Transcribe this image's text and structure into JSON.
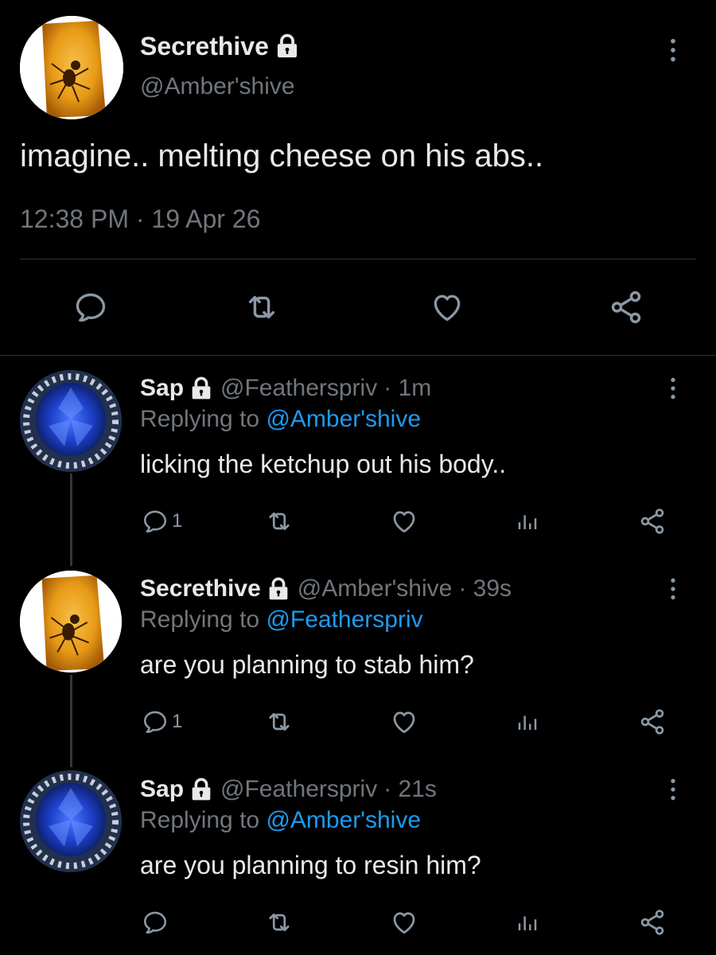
{
  "main_tweet": {
    "display_name": "Secrethive",
    "handle": "@Amber'shive",
    "text": "imagine.. melting cheese on his abs..",
    "timestamp": "12:38 PM · 19 Apr 26"
  },
  "replies": [
    {
      "display_name": "Sap",
      "handle": "@Featherspriv",
      "time": "· 1m",
      "replying_prefix": "Replying to",
      "replying_to": "@Amber'shive",
      "text": "licking the ketchup out his body..",
      "reply_count": "1"
    },
    {
      "display_name": "Secrethive",
      "handle": "@Amber'shive",
      "time": "· 39s",
      "replying_prefix": "Replying to",
      "replying_to": "@Featherspriv",
      "text": "are you planning to stab him?",
      "reply_count": "1"
    },
    {
      "display_name": "Sap",
      "handle": "@Featherspriv",
      "time": "· 21s",
      "replying_prefix": "Replying to",
      "replying_to": "@Amber'shive",
      "text": "are you planning to resin him?",
      "reply_count": ""
    }
  ],
  "colors": {
    "background": "#000000",
    "text": "#e7e9ea",
    "muted": "#71767b",
    "link": "#1d9bf0",
    "divider": "#2f3336"
  },
  "icons": {
    "reply": "reply-icon",
    "retweet": "retweet-icon",
    "like": "heart-icon",
    "analytics": "analytics-icon",
    "share": "share-icon",
    "more": "more-vertical-icon",
    "lock": "lock-icon"
  }
}
